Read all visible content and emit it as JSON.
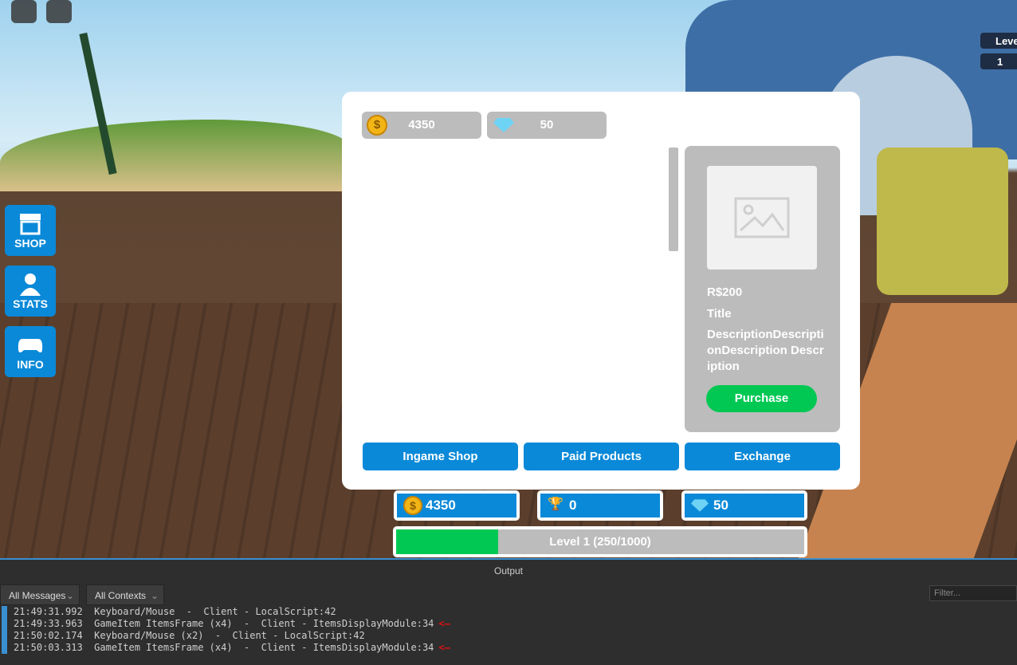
{
  "hud": {
    "level_label": "Level",
    "level_value": "1"
  },
  "sidebar": [
    {
      "label": "SHOP",
      "icon": "store-icon"
    },
    {
      "label": "STATS",
      "icon": "user-icon"
    },
    {
      "label": "INFO",
      "icon": "gamepad-icon"
    }
  ],
  "shop": {
    "coins": "4350",
    "gems": "50",
    "item": {
      "price": "R$200",
      "title": "Title",
      "description": "DescriptionDescriptionDescription Description",
      "purchase_label": "Purchase"
    },
    "tabs": [
      "Ingame Shop",
      "Paid Products",
      "Exchange"
    ]
  },
  "stats": {
    "coins": "4350",
    "trophies": "0",
    "gems": "50"
  },
  "xp": {
    "label": "Level 1 (250/1000)",
    "current": 250,
    "max": 1000
  },
  "colors": {
    "accent": "#0a89d8",
    "green": "#00c853",
    "panel_gray": "#bcbcbc"
  },
  "output": {
    "title": "Output",
    "filter_messages": "All Messages",
    "filter_contexts": "All Contexts",
    "filter_placeholder": "Filter...",
    "lines": [
      {
        "time": "21:49:31.992",
        "text": "Keyboard/Mouse  -  Client - LocalScript:42",
        "arrow": false
      },
      {
        "time": "21:49:33.963",
        "text": "GameItem ItemsFrame (x4)  -  Client - ItemsDisplayModule:34",
        "arrow": true
      },
      {
        "time": "21:50:02.174",
        "text": "Keyboard/Mouse (x2)  -  Client - LocalScript:42",
        "arrow": false
      },
      {
        "time": "21:50:03.313",
        "text": "GameItem ItemsFrame (x4)  -  Client - ItemsDisplayModule:34",
        "arrow": true
      }
    ]
  }
}
